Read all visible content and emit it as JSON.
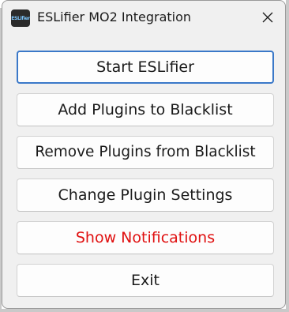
{
  "window": {
    "title": "ESLifier MO2 Integration",
    "icon": "eslifier-app-icon",
    "icon_text": "ESLifier",
    "close_icon": "close-icon"
  },
  "buttons": {
    "start": "Start ESLifier",
    "add_blacklist": "Add Plugins to Blacklist",
    "remove_blacklist": "Remove Plugins from Blacklist",
    "change_settings": "Change Plugin Settings",
    "show_notifications": "Show Notifications",
    "exit": "Exit"
  },
  "colors": {
    "window_bg": "#f0f0f0",
    "button_bg": "#fdfdfd",
    "focus_border": "#3a78c8",
    "notification_text": "#e01010"
  }
}
